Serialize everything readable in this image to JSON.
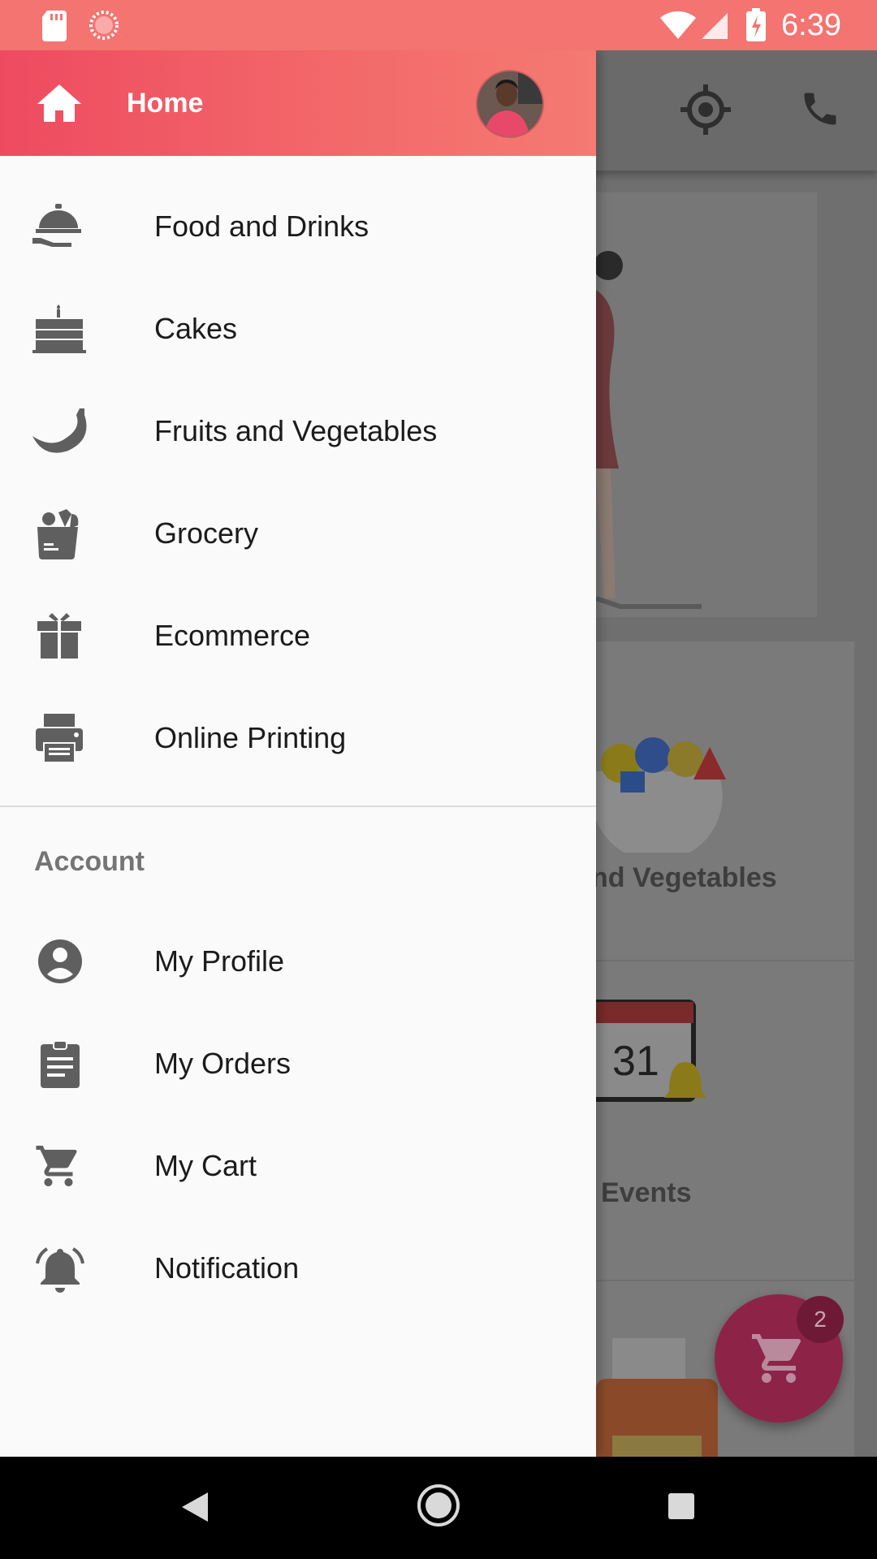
{
  "status_bar": {
    "time": "6:39",
    "icons": [
      "sd-card-icon",
      "sync-icon",
      "wifi-icon",
      "signal-icon",
      "battery-charging-icon"
    ]
  },
  "drawer": {
    "header": {
      "title": "Home",
      "icon": "home-icon"
    },
    "items": [
      {
        "label": "Food and Drinks",
        "icon": "food-cloche-icon"
      },
      {
        "label": "Cakes",
        "icon": "cake-icon"
      },
      {
        "label": "Fruits and Vegetables",
        "icon": "banana-icon"
      },
      {
        "label": "Grocery",
        "icon": "grocery-bag-icon"
      },
      {
        "label": "Ecommerce",
        "icon": "gift-icon"
      },
      {
        "label": "Online Printing",
        "icon": "printer-icon"
      }
    ],
    "account_section": {
      "heading": "Account",
      "items": [
        {
          "label": "My Profile",
          "icon": "account-circle-icon"
        },
        {
          "label": "My Orders",
          "icon": "clipboard-icon"
        },
        {
          "label": "My Cart",
          "icon": "cart-icon"
        },
        {
          "label": "Notification",
          "icon": "bell-icon"
        }
      ]
    }
  },
  "background": {
    "card_labels": [
      "nd Vegetables",
      "Events"
    ],
    "calendar_day": "31"
  },
  "fab": {
    "icon": "cart-icon",
    "badge": "2"
  },
  "colors": {
    "status_bar": "#f37470",
    "header_start": "#ee4b5f",
    "header_end": "#f47a72",
    "fab": "#8e2348",
    "drawer_bg": "#fafafa"
  }
}
